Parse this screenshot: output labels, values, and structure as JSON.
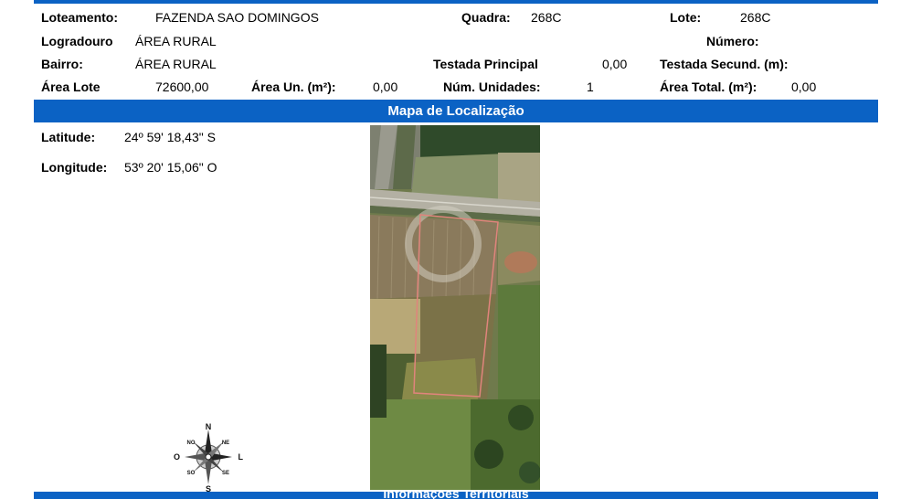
{
  "info": {
    "loteamento_label": "Loteamento:",
    "loteamento_value": "FAZENDA SAO DOMINGOS",
    "quadra_label": "Quadra:",
    "quadra_value": "268C",
    "lote_label": "Lote:",
    "lote_value": "268C",
    "logradouro_label": "Logradouro",
    "logradouro_value": "ÁREA RURAL",
    "numero_label": "Número:",
    "numero_value": "",
    "bairro_label": "Bairro:",
    "bairro_value": "ÁREA RURAL",
    "testada_principal_label": "Testada Principal",
    "testada_principal_value": "0,00",
    "testada_secund_label": "Testada Secund. (m):",
    "testada_secund_value": "",
    "area_lote_label": "Área Lote",
    "area_lote_value": "72600,00",
    "area_un_label": "Área Un. (m²):",
    "area_un_value": "0,00",
    "num_unidades_label": "Núm. Unidades:",
    "num_unidades_value": "1",
    "area_total_label": "Área Total. (m²):",
    "area_total_value": "0,00"
  },
  "map_section": {
    "title": "Mapa de Localização",
    "latitude_label": "Latitude:",
    "latitude_value": "24º 59' 18,43\" S",
    "longitude_label": "Longitude:",
    "longitude_value": "53º 20' 15,06\" O"
  },
  "compass": {
    "n": "N",
    "s": "S",
    "o": "O",
    "l": "L",
    "no": "NO",
    "ne": "NE",
    "so": "SO",
    "se": "SE"
  },
  "next_section": {
    "title": "Informações Territoriais"
  },
  "colors": {
    "section_bar": "#0b62c4",
    "lot_outline": "#e0847c"
  },
  "icons": {
    "compass": "compass-rose-icon",
    "map": "satellite-map-image"
  }
}
